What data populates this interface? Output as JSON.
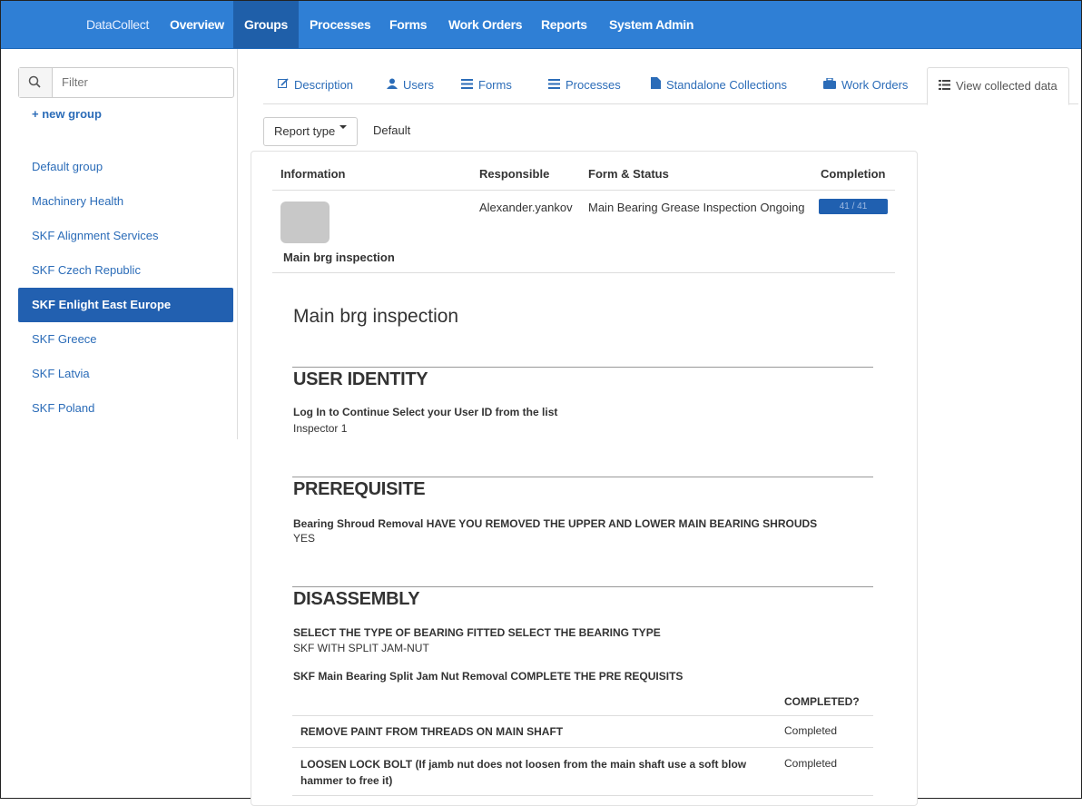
{
  "nav": {
    "brand": "DataCollect",
    "items": [
      "Overview",
      "Groups",
      "Processes",
      "Forms",
      "Work Orders",
      "Reports",
      "System Admin"
    ],
    "active": "Groups"
  },
  "sidebar": {
    "filter_placeholder": "Filter",
    "new_group": "+ new group",
    "groups": [
      "Default group",
      "Machinery Health",
      "SKF Alignment Services",
      "SKF Czech Republic",
      "SKF Enlight East Europe",
      "SKF Greece",
      "SKF Latvia",
      "SKF Poland"
    ],
    "active_group": "SKF Enlight East Europe"
  },
  "tabs": [
    {
      "label": "Description",
      "icon": "edit-icon"
    },
    {
      "label": "Users",
      "icon": "user-icon"
    },
    {
      "label": "Forms",
      "icon": "list-icon"
    },
    {
      "label": "Processes",
      "icon": "list-icon"
    },
    {
      "label": "Standalone Collections",
      "icon": "file-icon"
    },
    {
      "label": "Work Orders",
      "icon": "briefcase-icon"
    },
    {
      "label": "View collected data",
      "icon": "list-icon"
    }
  ],
  "report": {
    "type_button": "Report type",
    "type_value": "Default"
  },
  "table": {
    "headers": [
      "Information",
      "Responsible",
      "Form & Status",
      "Completion"
    ],
    "row": {
      "name": "Main brg inspection",
      "responsible": "Alexander.yankov",
      "form_status": "Main Bearing Grease Inspection Ongoing",
      "completion": "41 / 41",
      "completion_fraction": 1.0
    }
  },
  "collected": {
    "title": "Main brg inspection",
    "sections": [
      {
        "heading": "USER IDENTITY",
        "items": [
          {
            "question": "Log In to Continue Select your User ID from the list",
            "answer": "Inspector 1"
          }
        ]
      },
      {
        "heading": "PREREQUISITE",
        "items": [
          {
            "question": "Bearing Shroud Removal  HAVE YOU REMOVED THE UPPER AND LOWER MAIN BEARING SHROUDS",
            "answer": "YES"
          }
        ]
      },
      {
        "heading": "DISASSEMBLY",
        "items": [
          {
            "question": "SELECT THE TYPE OF BEARING FITTED SELECT THE BEARING TYPE",
            "answer": "SKF WITH SPLIT JAM-NUT"
          },
          {
            "question": "SKF Main Bearing Split Jam Nut Removal COMPLETE THE PRE REQUISITS",
            "answer": ""
          }
        ]
      }
    ],
    "checklist": {
      "column_header": "COMPLETED?",
      "rows": [
        {
          "task": "REMOVE PAINT FROM THREADS ON MAIN SHAFT",
          "status": "Completed"
        },
        {
          "task": "LOOSEN LOCK BOLT (If jamb nut does not loosen from the main shaft use a soft blow hammer to free it)",
          "status": "Completed"
        }
      ]
    }
  },
  "colors": {
    "navbar": "#2f7fd5",
    "nav_active": "#1f5fa9",
    "link": "#2b6cb8",
    "sidebar_active": "#2260b0",
    "progress": "#2060b0"
  }
}
